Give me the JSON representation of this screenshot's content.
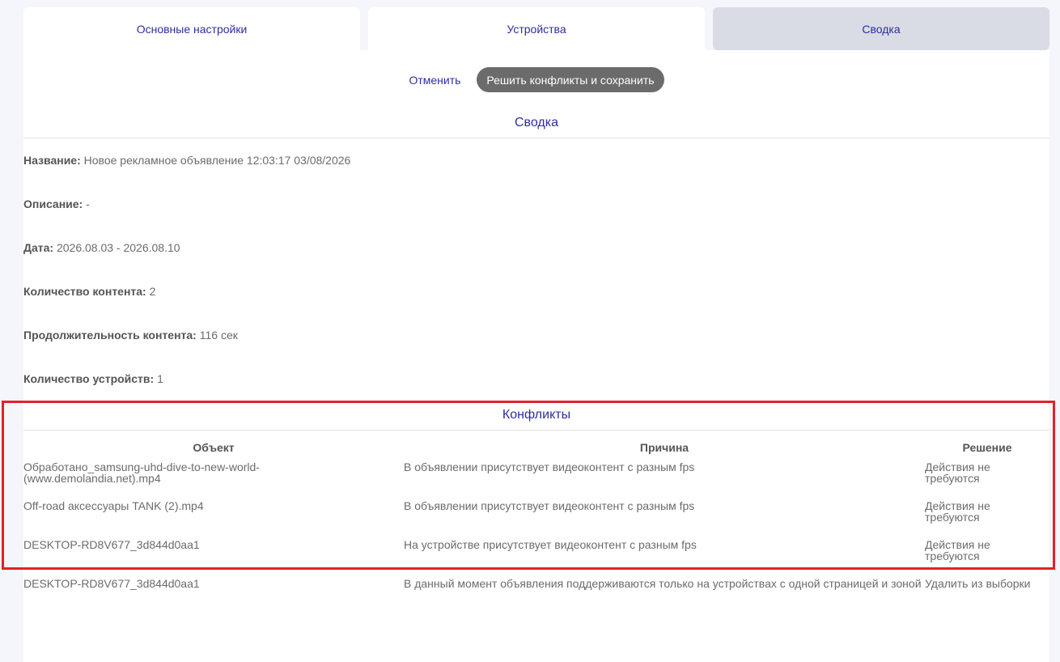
{
  "tabs": {
    "basic": "Основные настройки",
    "devices": "Устройства",
    "summary": "Сводка"
  },
  "actions": {
    "cancel": "Отменить",
    "resolve_save": "Решить конфликты и сохранить"
  },
  "summary": {
    "title": "Сводка",
    "name_label": "Название:",
    "name_value": "Новое рекламное объявление 12:03:17 03/08/2026",
    "description_label": "Описание:",
    "description_value": "-",
    "date_label": "Дата:",
    "date_value": "2026.08.03 - 2026.08.10",
    "content_count_label": "Количество контента:",
    "content_count_value": "2",
    "content_duration_label": "Продолжительность контента:",
    "content_duration_value": "116 сек",
    "device_count_label": "Количество устройств:",
    "device_count_value": "1"
  },
  "conflicts": {
    "title": "Конфликты",
    "headers": {
      "object": "Объект",
      "reason": "Причина",
      "solution": "Решение"
    },
    "rows": [
      {
        "object": "Обработано_samsung-uhd-dive-to-new-world-(www.demolandia.net).mp4",
        "reason": "В объявлении присутствует видеоконтент с разным fps",
        "solution": "Действия не требуются"
      },
      {
        "object": "Off-road аксессуары TANK (2).mp4",
        "reason": "В объявлении присутствует видеоконтент с разным fps",
        "solution": "Действия не требуются"
      },
      {
        "object": "DESKTOP-RD8V677_3d844d0aa1",
        "reason": "На устройстве присутствует видеоконтент с разным fps",
        "solution": "Действия не требуются"
      },
      {
        "object": "DESKTOP-RD8V677_3d844d0aa1",
        "reason": "В данный момент объявления поддерживаются только на устройствах с одной страницей и зоной",
        "solution": "Удалить из выборки"
      }
    ]
  },
  "colors": {
    "accent": "#2e2e9e",
    "highlight": "#e3202a",
    "button_bg": "#6b6b6b"
  }
}
